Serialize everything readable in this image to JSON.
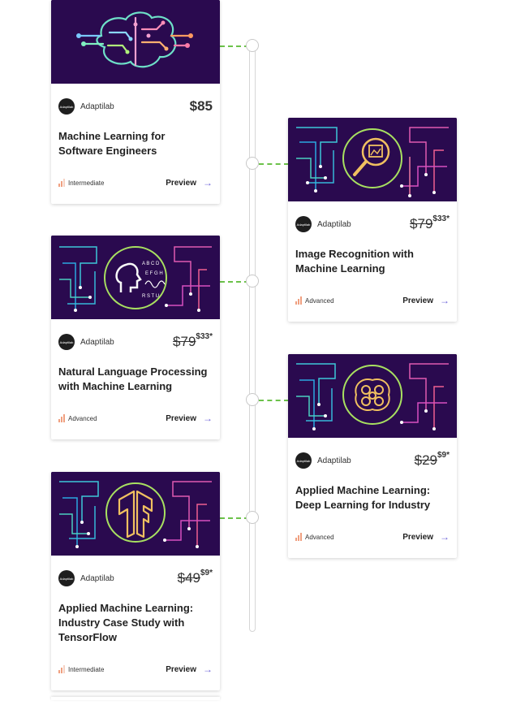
{
  "colors": {
    "card_bg": "#2a0a4f",
    "connector": "#6cc24a",
    "arrow": "#6c63d8",
    "level_bar": "#f0a080"
  },
  "courses": [
    {
      "image_icon": "brain-circuit-icon",
      "provider": "Adaptilab",
      "avatar_text": "Adaptilab",
      "price": "$85",
      "old_price": "",
      "sale_price": "",
      "title": "Machine Learning for Software Engineers",
      "level": "Intermediate",
      "preview": "Preview"
    },
    {
      "image_icon": "image-magnifier-icon",
      "provider": "Adaptilab",
      "avatar_text": "Adaptilab",
      "price": "",
      "old_price": "$79",
      "sale_price": "$33*",
      "title": "Image Recognition with Machine Learning",
      "level": "Advanced",
      "preview": "Preview"
    },
    {
      "image_icon": "head-letters-icon",
      "provider": "Adaptilab",
      "avatar_text": "Adaptilab",
      "price": "",
      "old_price": "$79",
      "sale_price": "$33*",
      "title": "Natural Language Processing with Machine Learning",
      "level": "Advanced",
      "preview": "Preview"
    },
    {
      "image_icon": "brain-circle-icon",
      "provider": "Adaptilab",
      "avatar_text": "Adaptilab",
      "price": "",
      "old_price": "$29",
      "sale_price": "$9*",
      "title": "Applied Machine Learning: Deep Learning for Industry",
      "level": "Advanced",
      "preview": "Preview"
    },
    {
      "image_icon": "tensorflow-icon",
      "provider": "Adaptilab",
      "avatar_text": "Adaptilab",
      "price": "",
      "old_price": "$49",
      "sale_price": "$9*",
      "title": "Applied Machine Learning: Industry Case Study with TensorFlow",
      "level": "Intermediate",
      "preview": "Preview"
    }
  ]
}
